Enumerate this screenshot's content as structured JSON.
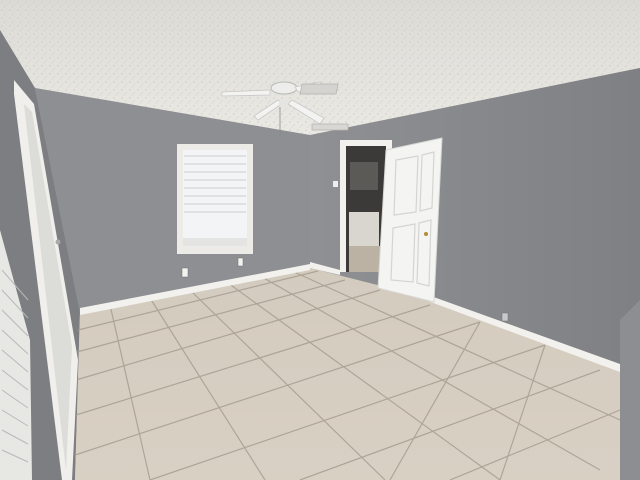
{
  "scene": {
    "subject": "empty-bedroom-interior",
    "colors": {
      "ceiling": "#e6e4df",
      "wall_back": "#8e8f93",
      "wall_right": "#8a8b8f",
      "wall_left": "#7d7e82",
      "floor_tile": "#d8cfc3",
      "grout": "#a79d90",
      "baseboard": "#f2f1ee",
      "door": "#f4f4f2",
      "window_light": "#f3f4f5"
    },
    "icons": [
      "ceiling-fan-icon",
      "window-blinds-icon",
      "door-icon",
      "outlet-icon"
    ]
  }
}
